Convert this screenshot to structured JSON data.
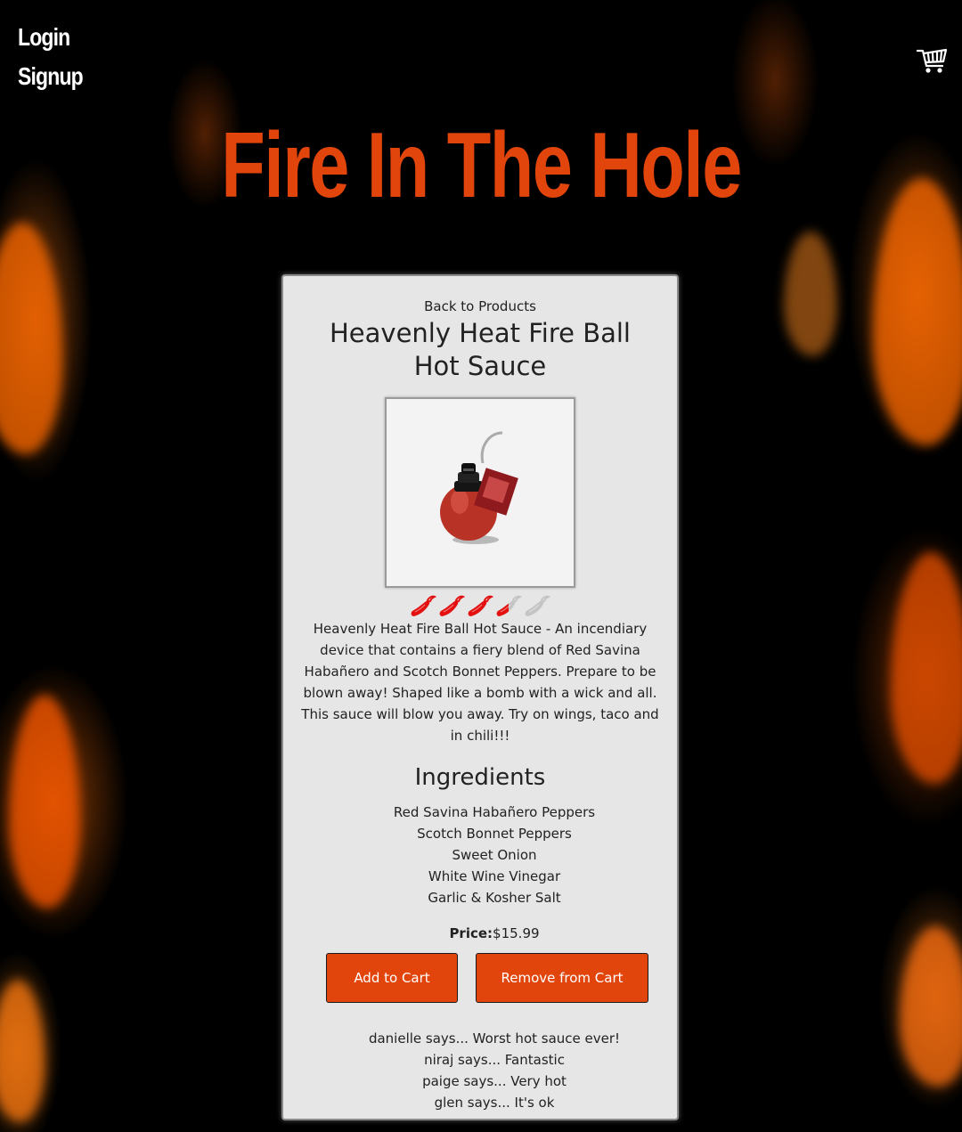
{
  "nav": {
    "login_label": "Login",
    "signup_label": "Signup",
    "cart_icon": "cart-icon"
  },
  "header": {
    "site_title": "Fire In The Hole"
  },
  "product": {
    "back_label": "Back to Products",
    "name": "Heavenly Heat Fire Ball Hot Sauce",
    "heat_rating": 3.5,
    "heat_max": 5,
    "description": "Heavenly Heat Fire Ball Hot Sauce - An incendiary device that contains a fiery blend of Red Savina Habañero and Scotch Bonnet Peppers. Prepare to be blown away! Shaped like a bomb with a wick and all. This sauce will blow you away. Try on wings, taco and in chili!!!",
    "ingredients_heading": "Ingredients",
    "ingredients": [
      "Red Savina Habañero Peppers",
      "Scotch Bonnet Peppers",
      "Sweet Onion",
      "White Wine Vinegar",
      "Garlic & Kosher Salt"
    ],
    "price_label": "Price:",
    "price_value": "$15.99",
    "add_label": "Add to Cart",
    "remove_label": "Remove from Cart",
    "reviews": [
      "danielle says... Worst hot sauce ever!",
      "niraj says... Fantastic",
      "paige says... Very hot",
      "glen says... It's ok"
    ]
  },
  "colors": {
    "accent": "#e2450c",
    "card_bg": "#e6e6e6",
    "pepper_on": "#e3100f",
    "pepper_off": "#c4c4c4"
  }
}
